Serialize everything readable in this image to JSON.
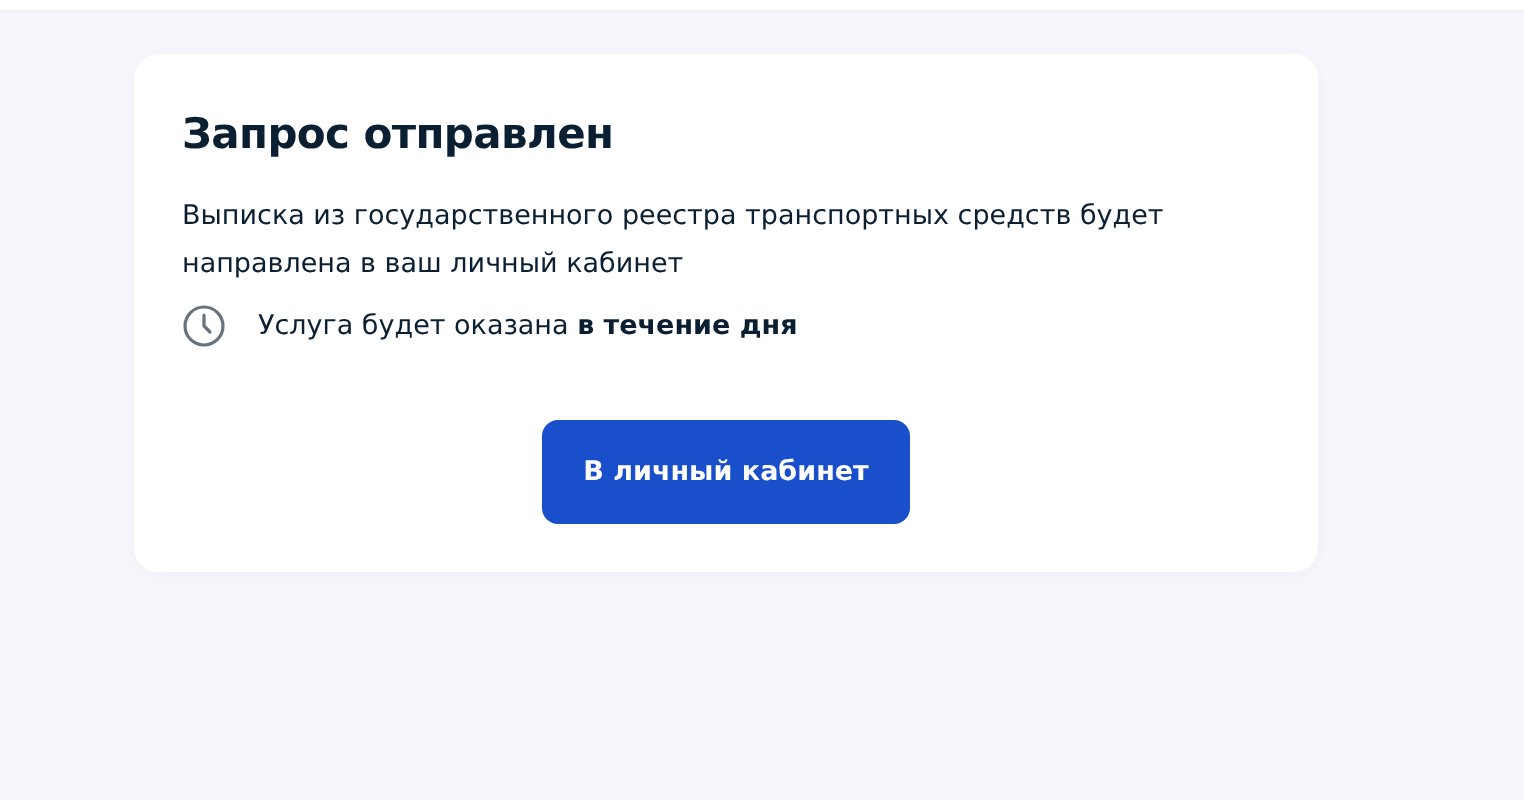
{
  "card": {
    "title": "Запрос отправлен",
    "description": "Выписка из государственного реестра транспортных средств будет направлена в ваш личный кабинет",
    "timing": "Услуга будет оказана **в течение дня**",
    "button": "В личный кабинет"
  }
}
